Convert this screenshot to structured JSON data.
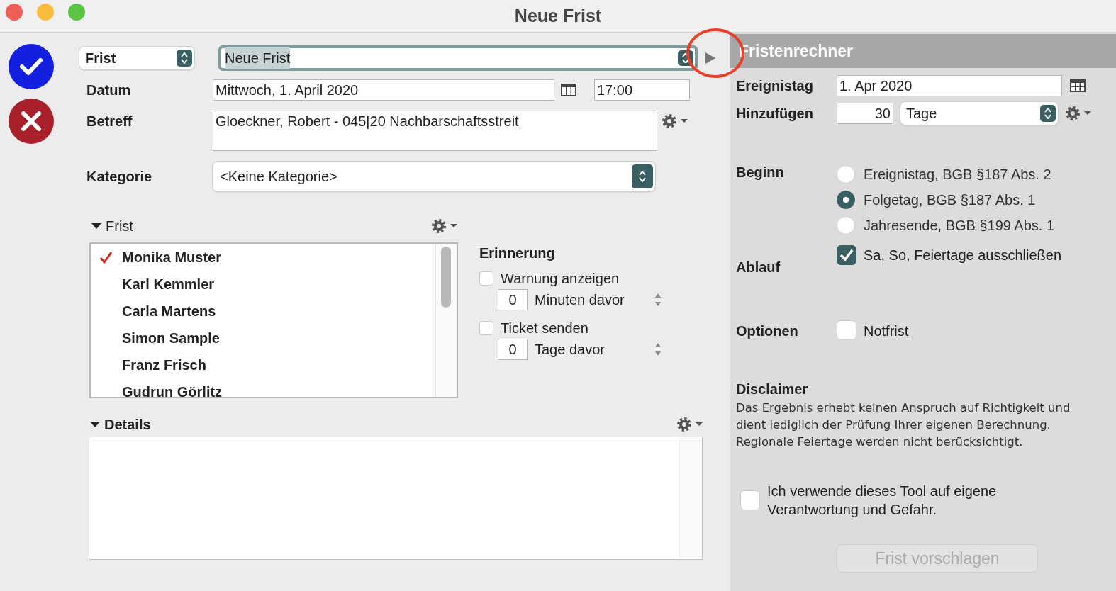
{
  "window": {
    "title": "Neue Frist"
  },
  "form": {
    "type_select": "Frist",
    "title_field": {
      "value": "Neue Frist",
      "text_selected": true
    },
    "datum": {
      "label": "Datum",
      "value": "Mittwoch, 1. April 2020",
      "time": "17:00"
    },
    "betreff": {
      "label": "Betreff",
      "value": "Gloeckner, Robert - 045|20 Nachbarschaftsstreit"
    },
    "kategorie": {
      "label": "Kategorie",
      "value": "<Keine Kategorie>"
    },
    "frist_section": {
      "label": "Frist",
      "expanded": true,
      "people": [
        {
          "name": "Monika Muster",
          "checked": true
        },
        {
          "name": "Karl Kemmler",
          "checked": false
        },
        {
          "name": "Carla Martens",
          "checked": false
        },
        {
          "name": "Simon Sample",
          "checked": false
        },
        {
          "name": "Franz Frisch",
          "checked": false
        },
        {
          "name": "Gudrun Görlitz",
          "checked": false
        }
      ]
    },
    "erinnerung": {
      "title": "Erinnerung",
      "options": [
        {
          "label": "Warnung anzeigen",
          "checked": false,
          "amount": "0",
          "unit": "Minuten davor"
        },
        {
          "label": "Ticket senden",
          "checked": false,
          "amount": "0",
          "unit": "Tage davor"
        }
      ]
    },
    "details": {
      "label": "Details",
      "expanded": true
    }
  },
  "calculator": {
    "title": "Fristenrechner",
    "ereignistag": {
      "label": "Ereignistag",
      "value": "1. Apr 2020"
    },
    "hinzufuegen": {
      "label": "Hinzufügen",
      "amount": "30",
      "unit": "Tage"
    },
    "beginn": {
      "label": "Beginn",
      "options": [
        {
          "label": "Ereignistag, BGB §187 Abs. 2",
          "selected": false
        },
        {
          "label": "Folgetag, BGB §187 Abs. 1",
          "selected": true
        },
        {
          "label": "Jahresende, BGB §199 Abs. 1",
          "selected": false
        }
      ]
    },
    "ablauf": {
      "label": "Ablauf",
      "option": "Sa, So, Feiertage ausschließen",
      "checked": true
    },
    "optionen": {
      "label": "Optionen",
      "option": "Notfrist",
      "checked": false
    },
    "disclaimer": {
      "title": "Disclaimer",
      "text": "Das Ergebnis erhebt keinen Anspruch auf Richtigkeit und dient lediglich der Prüfung Ihrer eigenen Berechnung. Regionale Feiertage werden nicht berücksichtigt."
    },
    "consent": {
      "label": "Ich verwende dieses Tool auf eigene Verantwortung und Gefahr.",
      "checked": false
    },
    "button": {
      "label": "Frist vorschlagen",
      "disabled": true
    }
  }
}
